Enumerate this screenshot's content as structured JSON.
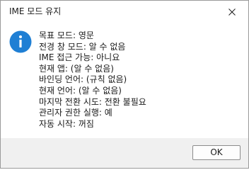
{
  "window": {
    "title": "IME 모드 유지",
    "close_icon": "close-icon"
  },
  "message": {
    "icon": "info-icon",
    "lines": [
      "목표 모드: 영문",
      "전경 창 모드: 알 수 없음",
      "IME 접근 가능: 아니요",
      "현재 앱: (알 수 없음)",
      "바인딩 언어: (규칙 없음)",
      "현재 언어: (알 수 없음)",
      "마지막 전환 시도: 전환 불필요",
      "관리자 권한 실행: 예",
      "자동 시작: 꺼짐"
    ]
  },
  "buttons": {
    "ok_label": "OK"
  },
  "colors": {
    "info_icon": "#1f7fd4",
    "footer_bg": "#f0f0f0",
    "button_border": "#8c8c8c",
    "window_border": "#9a9a9a"
  }
}
